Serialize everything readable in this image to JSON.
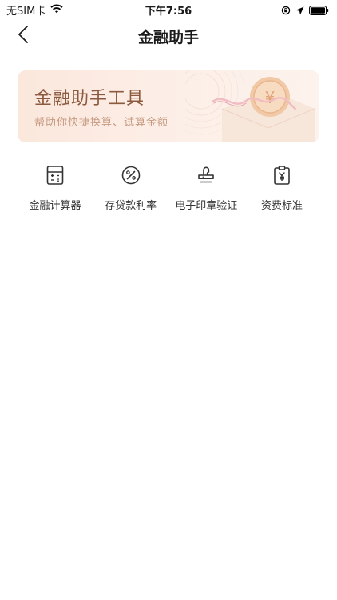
{
  "status_bar": {
    "carrier": "无SIM卡",
    "time": "下午7:56",
    "icons": [
      "wifi-icon",
      "orientation-lock-icon",
      "location-arrow-icon",
      "battery-icon"
    ]
  },
  "nav": {
    "title": "金融助手",
    "back_icon": "chevron-left-icon"
  },
  "banner": {
    "title": "金融助手工具",
    "subtitle": "帮助你快捷换算、试算金额",
    "coin_symbol": "¥",
    "icon": "envelope-coin-illustration"
  },
  "tools": [
    {
      "label": "金融计算器",
      "icon": "calculator-icon"
    },
    {
      "label": "存贷款利率",
      "icon": "percent-icon"
    },
    {
      "label": "电子印章验证",
      "icon": "stamp-icon"
    },
    {
      "label": "资费标准",
      "icon": "fee-clipboard-icon"
    }
  ],
  "colors": {
    "banner_title": "#8c5a3e",
    "banner_subtitle": "#c5997f",
    "banner_bg": "#fbe7dc",
    "icon_stroke": "#333333"
  }
}
